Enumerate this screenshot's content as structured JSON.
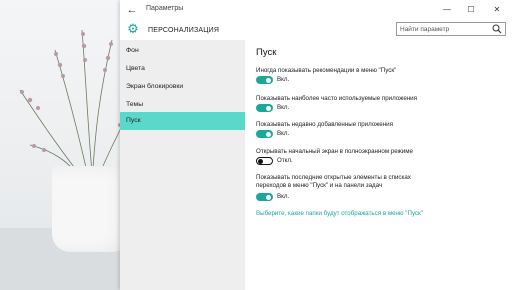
{
  "window": {
    "title": "Параметры",
    "back_icon": "back-arrow-icon",
    "controls": {
      "minimize": "—",
      "maximize": "☐",
      "close": "✕"
    }
  },
  "header": {
    "icon": "gear-icon",
    "title": "ПЕРСОНАЛИЗАЦИЯ",
    "search_placeholder": "Найти параметр"
  },
  "sidebar": {
    "items": [
      {
        "label": "Фон"
      },
      {
        "label": "Цвета"
      },
      {
        "label": "Экран блокировки"
      },
      {
        "label": "Темы"
      },
      {
        "label": "Пуск"
      }
    ],
    "active_index": 4
  },
  "main": {
    "title": "Пуск",
    "options": [
      {
        "label": "Иногда показывать рекомендации в меню \"Пуск\"",
        "state": "Вкл.",
        "on": true
      },
      {
        "label": "Показывать наиболее часто используемые приложения",
        "state": "Вкл.",
        "on": true
      },
      {
        "label": "Показывать недавно добавленные приложения",
        "state": "Вкл.",
        "on": true
      },
      {
        "label": "Открывать начальный экран в полноэкранном режиме",
        "state": "Откл.",
        "on": false
      },
      {
        "label_line1": "Показывать последние открытые элементы в списках",
        "label_line2": "переходов в меню \"Пуск\" и на панели задач",
        "state": "Вкл.",
        "on": true
      }
    ],
    "link": "Выберите, какие папки будут отображаться в меню \"Пуск\""
  },
  "colors": {
    "accent": "#1aa89a",
    "active_nav": "#5ad9cb"
  }
}
